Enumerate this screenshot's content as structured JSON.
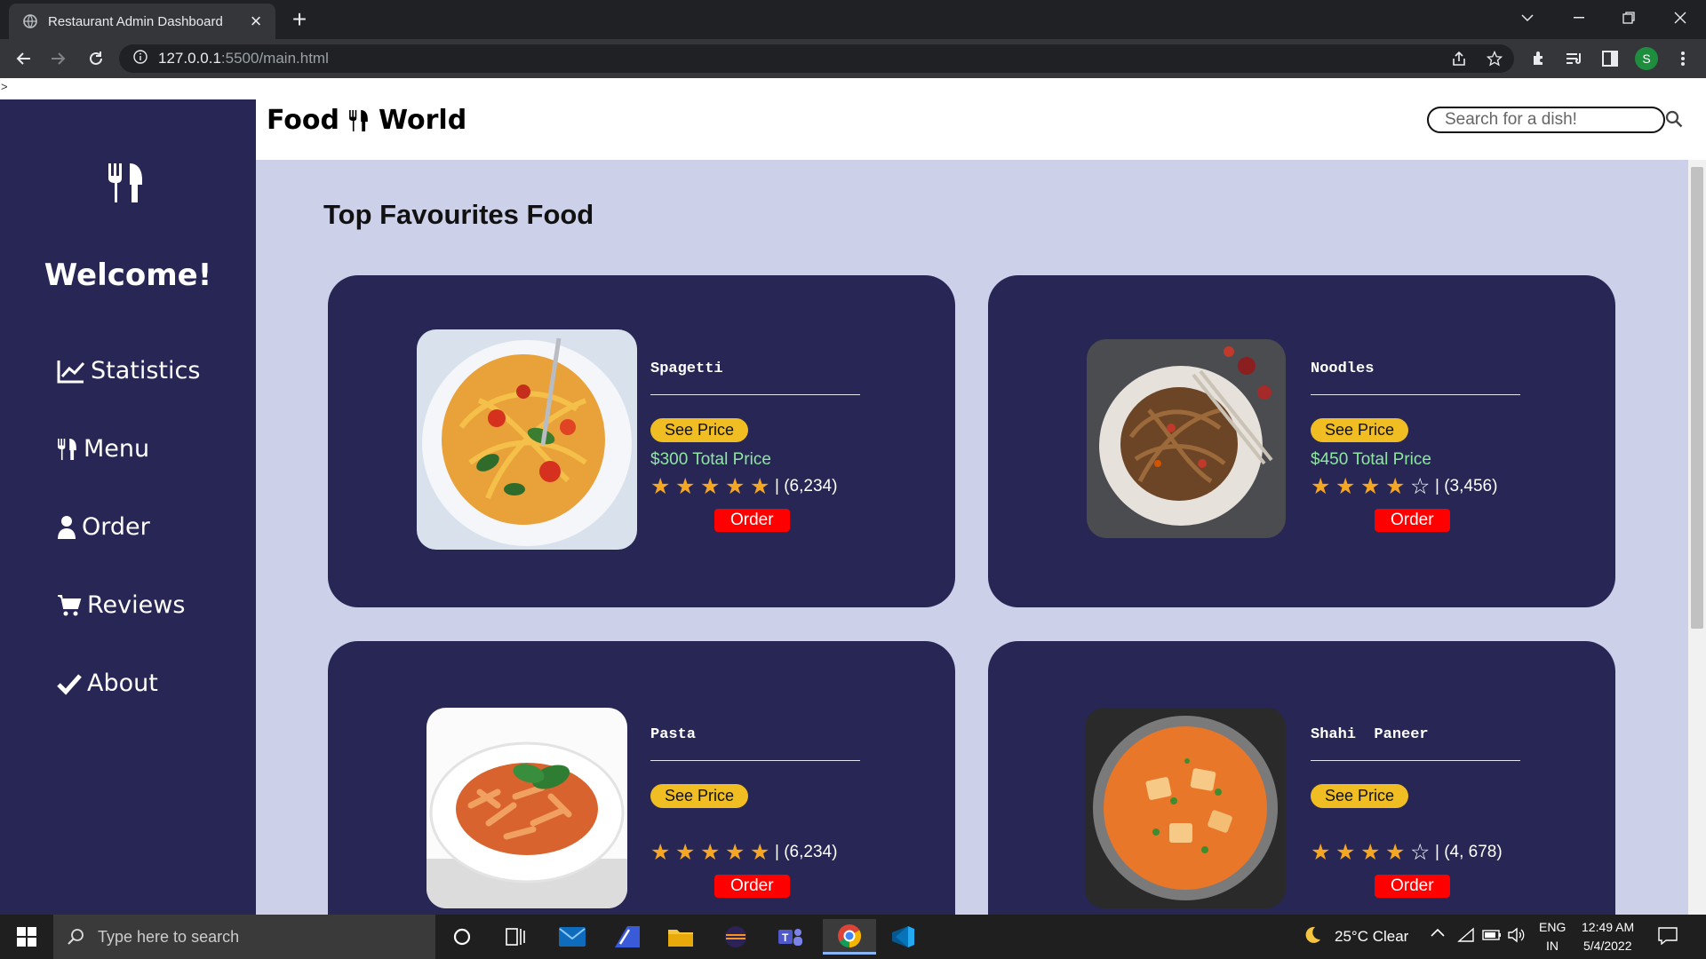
{
  "browser": {
    "tab_title": "Restaurant Admin Dashboard",
    "url_host": "127.0.0.1",
    "url_path": ":5500/main.html",
    "profile_initial": "S"
  },
  "page": {
    "stray_text": ">"
  },
  "sidebar": {
    "welcome": "Welcome!",
    "items": [
      {
        "label": "Statistics",
        "icon": "chart-line-icon"
      },
      {
        "label": "Menu",
        "icon": "utensils-icon"
      },
      {
        "label": "Order",
        "icon": "user-icon"
      },
      {
        "label": "Reviews",
        "icon": "cart-icon"
      },
      {
        "label": "About",
        "icon": "check-icon"
      }
    ]
  },
  "header": {
    "brand_left": "Food",
    "brand_right": "World",
    "search_placeholder": "Search for a dish!"
  },
  "main": {
    "section_title": "Top Favourites Food",
    "cards": [
      {
        "name": "Spagetti",
        "price_label": "See Price",
        "total": "$300 Total Price",
        "stars": 5,
        "reviews": "| (6,234)",
        "order_label": "Order"
      },
      {
        "name": "Noodles",
        "price_label": "See Price",
        "total": "$450 Total Price",
        "stars": 4,
        "reviews": "| (3,456)",
        "order_label": "Order"
      },
      {
        "name": "Pasta",
        "price_label": "See Price",
        "total": "",
        "stars": 5,
        "reviews": "| (6,234)",
        "order_label": "Order"
      },
      {
        "name": "Shahi  Paneer",
        "price_label": "See Price",
        "total": "",
        "stars": 4,
        "reviews": "| (4, 678)",
        "order_label": "Order"
      }
    ]
  },
  "taskbar": {
    "search_placeholder": "Type here to search",
    "weather": "25°C  Clear",
    "lang_top": "ENG",
    "lang_bottom": "IN",
    "time": "12:49 AM",
    "date": "5/4/2022"
  },
  "colors": {
    "sidebar_bg": "#272654",
    "main_bg": "#cdd0e9",
    "star": "#f5a623",
    "price_button": "#f0bd22",
    "order_button": "#ff0000",
    "total_price": "#8ee6a0"
  }
}
